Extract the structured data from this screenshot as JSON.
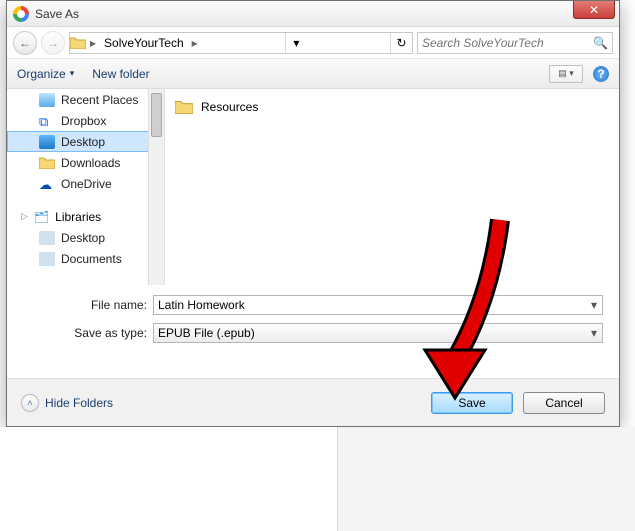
{
  "window": {
    "title": "Save As",
    "close": "✕"
  },
  "nav": {
    "breadcrumb": {
      "folder": "SolveYourTech",
      "sep1": "▸",
      "sep2": "▸"
    },
    "search_placeholder": "Search SolveYourTech",
    "back": "←",
    "fwd": "→",
    "dropdown": "▾",
    "refresh": "↻"
  },
  "toolbar": {
    "organize": "Organize",
    "organize_arrow": "▾",
    "newfolder": "New folder",
    "help": "?"
  },
  "sidebar": {
    "items": [
      {
        "label": "Recent Places",
        "icon": "recent"
      },
      {
        "label": "Dropbox",
        "icon": "dropbox"
      },
      {
        "label": "Desktop",
        "icon": "desktop",
        "selected": true
      },
      {
        "label": "Downloads",
        "icon": "downloads"
      },
      {
        "label": "OneDrive",
        "icon": "onedrive"
      }
    ],
    "libraries": {
      "label": "Libraries",
      "items": [
        {
          "label": "Desktop"
        },
        {
          "label": "Documents"
        }
      ]
    }
  },
  "content": {
    "items": [
      {
        "label": "Resources",
        "type": "folder"
      }
    ]
  },
  "fields": {
    "filename_label": "File name:",
    "filename_value": "Latin Homework",
    "savetype_label": "Save as type:",
    "savetype_value": "EPUB File (.epub)"
  },
  "footer": {
    "hidefolders": "Hide Folders",
    "save": "Save",
    "cancel": "Cancel"
  }
}
